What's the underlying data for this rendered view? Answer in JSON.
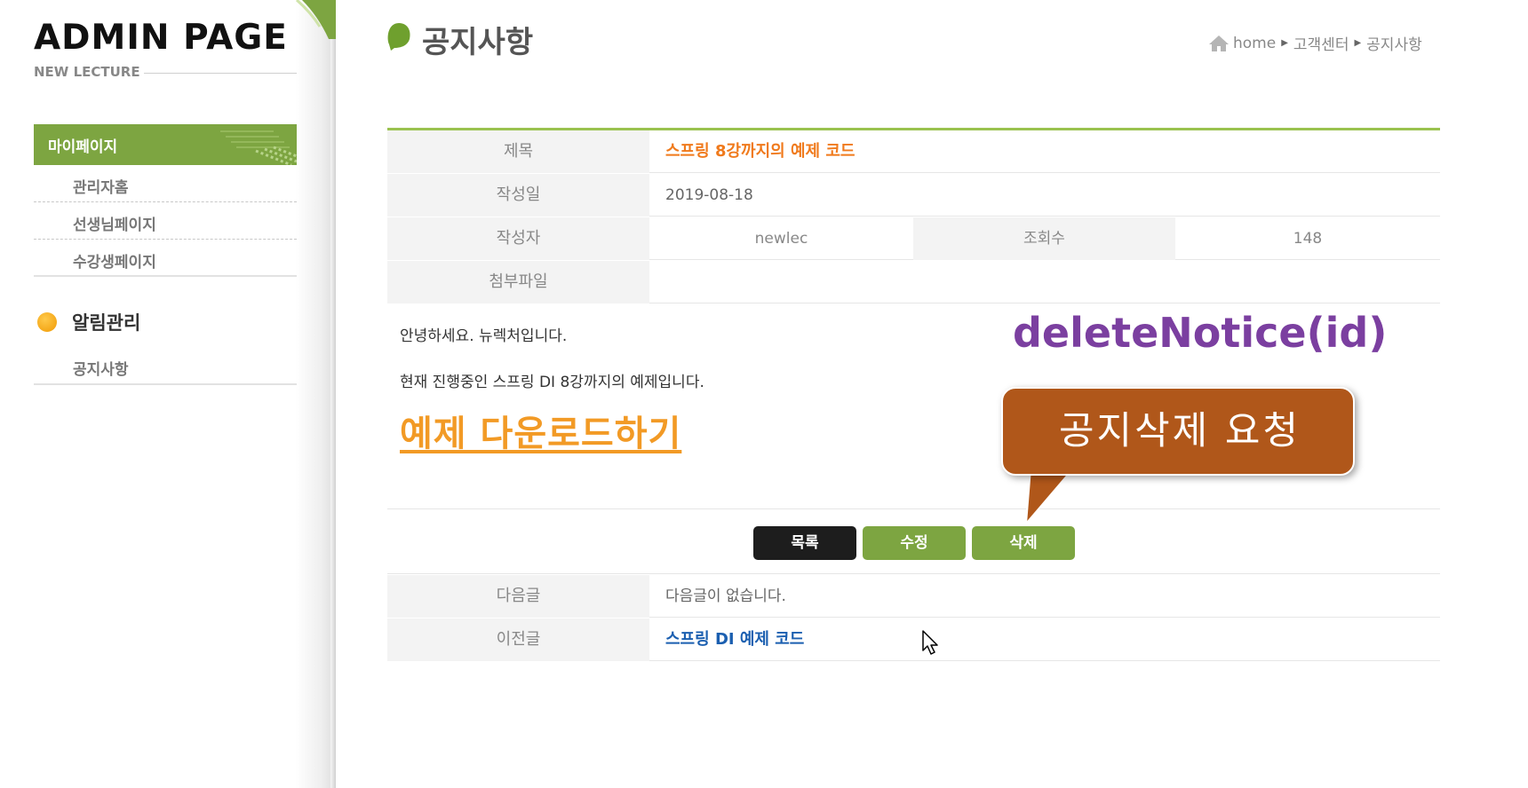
{
  "sidebar": {
    "title": "ADMIN PAGE",
    "subtitle": "NEW LECTURE",
    "menu_header": "마이페이지",
    "menu_items": [
      "관리자홈",
      "선생님페이지",
      "수강생페이지"
    ],
    "section2_title": "알림관리",
    "section2_items": [
      "공지사항"
    ]
  },
  "page": {
    "title": "공지사항",
    "breadcrumb": [
      "home",
      "고객센터",
      "공지사항"
    ]
  },
  "notice": {
    "title_label": "제목",
    "title_value": "스프링 8강까지의 예제 코드",
    "date_label": "작성일",
    "date_value": "2019-08-18",
    "writer_label": "작성자",
    "writer_value": "newlec",
    "hit_label": "조회수",
    "hit_value": "148",
    "file_label": "첨부파일",
    "file_value": "",
    "content_line1": "안녕하세요. 뉴렉처입니다.",
    "content_line2": "현재 진행중인 스프링 DI 8강까지의 예제입니다.",
    "download_link": "예제 다운로드하기"
  },
  "annotation": {
    "code": "deleteNotice(id)",
    "callout": "공지삭제 요청",
    "code_color": "#7b3fa0",
    "callout_color": "#b0571a"
  },
  "buttons": {
    "list": "목록",
    "edit": "수정",
    "delete": "삭제"
  },
  "nav": {
    "next_label": "다음글",
    "next_value": "다음글이 없습니다.",
    "prev_label": "이전글",
    "prev_value": "스프링 DI 예제 코드"
  },
  "colors": {
    "accent_green": "#7da541",
    "title_orange": "#f07a1c",
    "link_blue": "#1b5fb0"
  }
}
